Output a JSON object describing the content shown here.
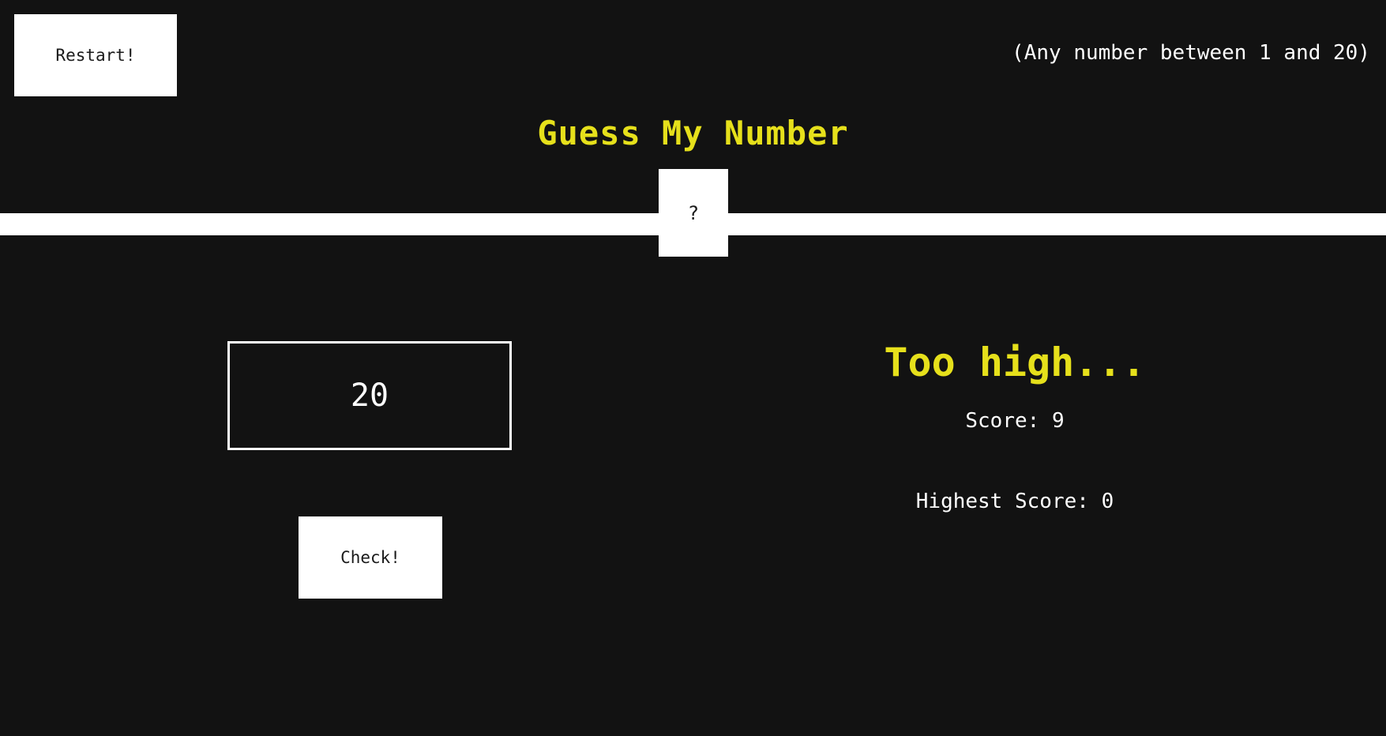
{
  "header": {
    "restart_label": "Restart!",
    "range_hint": "(Any number between 1 and 20)"
  },
  "title": "Guess My Number",
  "secret": {
    "display": "?"
  },
  "guess": {
    "value": "20"
  },
  "check_label": "Check!",
  "status": {
    "message": "Too high...",
    "score_label": "Score:",
    "score_value": "9",
    "highscore_label": "Highest Score:",
    "highscore_value": "0"
  },
  "colors": {
    "background": "#121212",
    "accent": "#e6e01b",
    "foreground": "#ffffff"
  }
}
